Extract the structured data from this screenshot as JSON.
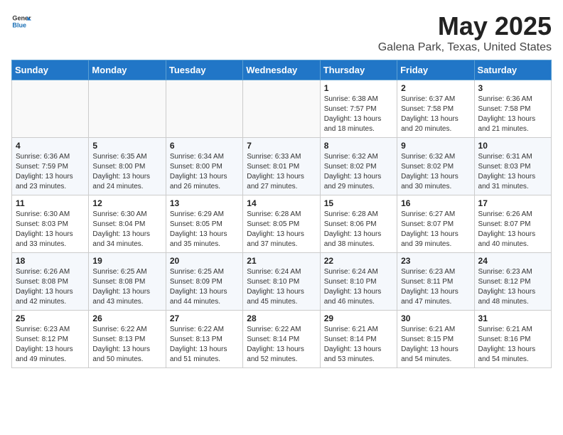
{
  "header": {
    "logo_general": "General",
    "logo_blue": "Blue",
    "title": "May 2025",
    "subtitle": "Galena Park, Texas, United States"
  },
  "calendar": {
    "weekdays": [
      "Sunday",
      "Monday",
      "Tuesday",
      "Wednesday",
      "Thursday",
      "Friday",
      "Saturday"
    ],
    "weeks": [
      [
        {
          "day": "",
          "content": ""
        },
        {
          "day": "",
          "content": ""
        },
        {
          "day": "",
          "content": ""
        },
        {
          "day": "",
          "content": ""
        },
        {
          "day": "1",
          "content": "Sunrise: 6:38 AM\nSunset: 7:57 PM\nDaylight: 13 hours\nand 18 minutes."
        },
        {
          "day": "2",
          "content": "Sunrise: 6:37 AM\nSunset: 7:58 PM\nDaylight: 13 hours\nand 20 minutes."
        },
        {
          "day": "3",
          "content": "Sunrise: 6:36 AM\nSunset: 7:58 PM\nDaylight: 13 hours\nand 21 minutes."
        }
      ],
      [
        {
          "day": "4",
          "content": "Sunrise: 6:36 AM\nSunset: 7:59 PM\nDaylight: 13 hours\nand 23 minutes."
        },
        {
          "day": "5",
          "content": "Sunrise: 6:35 AM\nSunset: 8:00 PM\nDaylight: 13 hours\nand 24 minutes."
        },
        {
          "day": "6",
          "content": "Sunrise: 6:34 AM\nSunset: 8:00 PM\nDaylight: 13 hours\nand 26 minutes."
        },
        {
          "day": "7",
          "content": "Sunrise: 6:33 AM\nSunset: 8:01 PM\nDaylight: 13 hours\nand 27 minutes."
        },
        {
          "day": "8",
          "content": "Sunrise: 6:32 AM\nSunset: 8:02 PM\nDaylight: 13 hours\nand 29 minutes."
        },
        {
          "day": "9",
          "content": "Sunrise: 6:32 AM\nSunset: 8:02 PM\nDaylight: 13 hours\nand 30 minutes."
        },
        {
          "day": "10",
          "content": "Sunrise: 6:31 AM\nSunset: 8:03 PM\nDaylight: 13 hours\nand 31 minutes."
        }
      ],
      [
        {
          "day": "11",
          "content": "Sunrise: 6:30 AM\nSunset: 8:03 PM\nDaylight: 13 hours\nand 33 minutes."
        },
        {
          "day": "12",
          "content": "Sunrise: 6:30 AM\nSunset: 8:04 PM\nDaylight: 13 hours\nand 34 minutes."
        },
        {
          "day": "13",
          "content": "Sunrise: 6:29 AM\nSunset: 8:05 PM\nDaylight: 13 hours\nand 35 minutes."
        },
        {
          "day": "14",
          "content": "Sunrise: 6:28 AM\nSunset: 8:05 PM\nDaylight: 13 hours\nand 37 minutes."
        },
        {
          "day": "15",
          "content": "Sunrise: 6:28 AM\nSunset: 8:06 PM\nDaylight: 13 hours\nand 38 minutes."
        },
        {
          "day": "16",
          "content": "Sunrise: 6:27 AM\nSunset: 8:07 PM\nDaylight: 13 hours\nand 39 minutes."
        },
        {
          "day": "17",
          "content": "Sunrise: 6:26 AM\nSunset: 8:07 PM\nDaylight: 13 hours\nand 40 minutes."
        }
      ],
      [
        {
          "day": "18",
          "content": "Sunrise: 6:26 AM\nSunset: 8:08 PM\nDaylight: 13 hours\nand 42 minutes."
        },
        {
          "day": "19",
          "content": "Sunrise: 6:25 AM\nSunset: 8:08 PM\nDaylight: 13 hours\nand 43 minutes."
        },
        {
          "day": "20",
          "content": "Sunrise: 6:25 AM\nSunset: 8:09 PM\nDaylight: 13 hours\nand 44 minutes."
        },
        {
          "day": "21",
          "content": "Sunrise: 6:24 AM\nSunset: 8:10 PM\nDaylight: 13 hours\nand 45 minutes."
        },
        {
          "day": "22",
          "content": "Sunrise: 6:24 AM\nSunset: 8:10 PM\nDaylight: 13 hours\nand 46 minutes."
        },
        {
          "day": "23",
          "content": "Sunrise: 6:23 AM\nSunset: 8:11 PM\nDaylight: 13 hours\nand 47 minutes."
        },
        {
          "day": "24",
          "content": "Sunrise: 6:23 AM\nSunset: 8:12 PM\nDaylight: 13 hours\nand 48 minutes."
        }
      ],
      [
        {
          "day": "25",
          "content": "Sunrise: 6:23 AM\nSunset: 8:12 PM\nDaylight: 13 hours\nand 49 minutes."
        },
        {
          "day": "26",
          "content": "Sunrise: 6:22 AM\nSunset: 8:13 PM\nDaylight: 13 hours\nand 50 minutes."
        },
        {
          "day": "27",
          "content": "Sunrise: 6:22 AM\nSunset: 8:13 PM\nDaylight: 13 hours\nand 51 minutes."
        },
        {
          "day": "28",
          "content": "Sunrise: 6:22 AM\nSunset: 8:14 PM\nDaylight: 13 hours\nand 52 minutes."
        },
        {
          "day": "29",
          "content": "Sunrise: 6:21 AM\nSunset: 8:14 PM\nDaylight: 13 hours\nand 53 minutes."
        },
        {
          "day": "30",
          "content": "Sunrise: 6:21 AM\nSunset: 8:15 PM\nDaylight: 13 hours\nand 54 minutes."
        },
        {
          "day": "31",
          "content": "Sunrise: 6:21 AM\nSunset: 8:16 PM\nDaylight: 13 hours\nand 54 minutes."
        }
      ]
    ]
  }
}
